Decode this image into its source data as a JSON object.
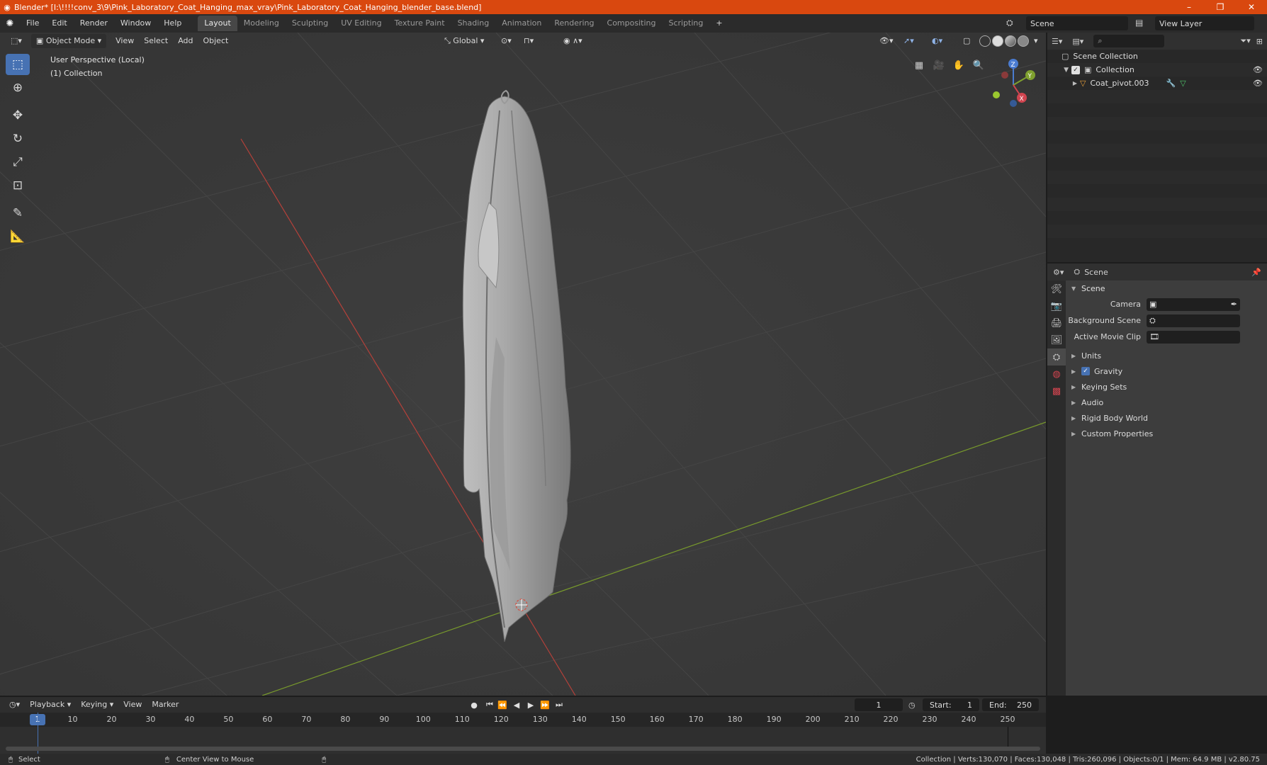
{
  "window": {
    "title": "Blender* [I:\\!!!!conv_3\\9\\Pink_Laboratory_Coat_Hanging_max_vray\\Pink_Laboratory_Coat_Hanging_blender_base.blend]",
    "minimize": "–",
    "restore": "❐",
    "close": "✕"
  },
  "menu": [
    "File",
    "Edit",
    "Render",
    "Window",
    "Help"
  ],
  "workspaces": [
    "Layout",
    "Modeling",
    "Sculpting",
    "UV Editing",
    "Texture Paint",
    "Shading",
    "Animation",
    "Rendering",
    "Compositing",
    "Scripting"
  ],
  "active_workspace": "Layout",
  "scene_name": "Scene",
  "view_layer": "View Layer",
  "viewport": {
    "mode": "Object Mode",
    "menus": [
      "View",
      "Select",
      "Add",
      "Object"
    ],
    "orientation": "Global",
    "perspective_label": "User Perspective (Local)",
    "collection_label": "(1) Collection",
    "axis_x": "X",
    "axis_y": "Y",
    "axis_z": "Z"
  },
  "outliner": {
    "root": "Scene Collection",
    "collection": "Collection",
    "object": "Coat_pivot.003"
  },
  "properties": {
    "context": "Scene",
    "panel": "Scene",
    "camera_label": "Camera",
    "background_scene_label": "Background Scene",
    "active_movie_clip_label": "Active Movie Clip",
    "subpanels": [
      "Units",
      "Gravity",
      "Keying Sets",
      "Audio",
      "Rigid Body World",
      "Custom Properties"
    ],
    "gravity_checked": true
  },
  "timeline": {
    "menus": [
      "Playback",
      "Keying",
      "View",
      "Marker"
    ],
    "current_frame": "1",
    "start_label": "Start:",
    "start": "1",
    "end_label": "End:",
    "end": "250",
    "ruler": [
      "10",
      "20",
      "30",
      "40",
      "50",
      "60",
      "70",
      "80",
      "90",
      "100",
      "110",
      "120",
      "130",
      "140",
      "150",
      "160",
      "170",
      "180",
      "190",
      "200",
      "210",
      "220",
      "230",
      "240",
      "250"
    ]
  },
  "statusbar": {
    "left": "Select",
    "middle": "Center View to Mouse",
    "stats": "Collection | Verts:130,070 | Faces:130,048 | Tris:260,096 | Objects:0/1 | Mem: 64.9 MB | v2.80.75"
  },
  "colors": {
    "titlebar": "#d9480f",
    "accent": "#4772b3",
    "x_axis": "#c0392b",
    "y_axis": "#7fa02f"
  }
}
